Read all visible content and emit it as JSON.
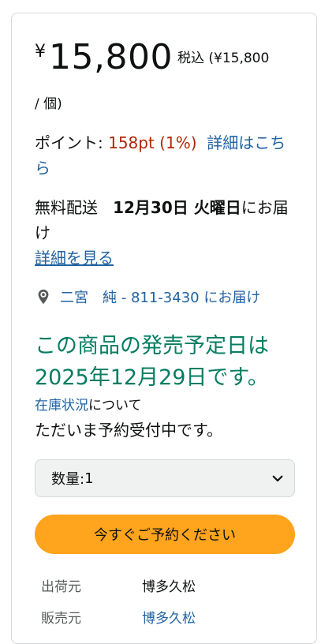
{
  "price": {
    "currency": "¥",
    "amount": "15,800",
    "tax_label": "税込 (¥15,800",
    "tax_cont": "/ 個)"
  },
  "points": {
    "label": "ポイント: ",
    "value": "158pt  (1%)",
    "details_link": "詳細はこちら"
  },
  "delivery": {
    "prefix": "無料配送",
    "date": "12月30日 火曜日",
    "suffix": "にお届け",
    "details_link": "詳細を見る"
  },
  "address": {
    "icon": "location-pin-icon",
    "text": "二宮　純 - 811-3430 にお届け"
  },
  "release_notice": "この商品の発売予定日は2025年12月29日です。",
  "stock": {
    "link": "在庫状況",
    "suffix": "について",
    "status": "ただいま予約受付中です。"
  },
  "quantity": {
    "label": "数量: ",
    "value": "1"
  },
  "buy_button": "今すぐご予約ください",
  "seller_info": {
    "ships_from_label": "出荷元",
    "ships_from_value": "博多久松",
    "sold_by_label": "販売元",
    "sold_by_value": "博多久松"
  },
  "colors": {
    "price_red": "#b12704",
    "link_blue": "#2162a1",
    "release_green": "#067d62",
    "button_orange": "#ffa41c"
  }
}
